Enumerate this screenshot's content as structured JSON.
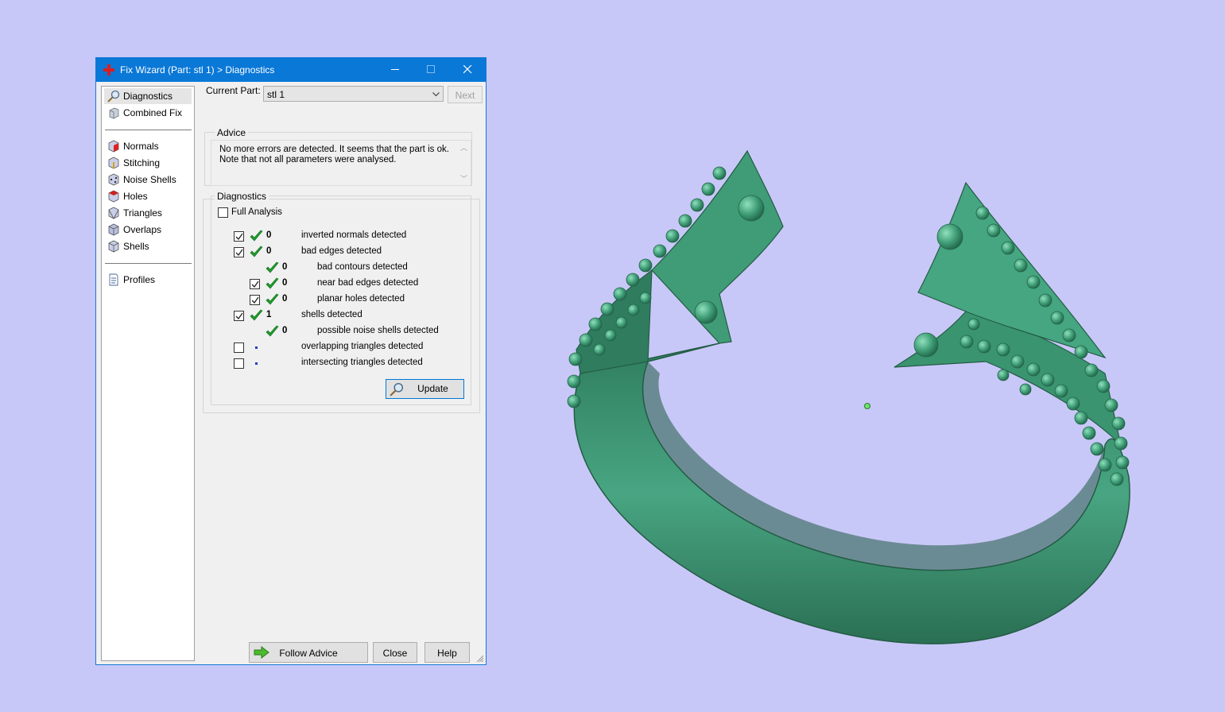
{
  "window": {
    "title": "Fix Wizard (Part: stl 1) > Diagnostics",
    "controls": {
      "minimize": "minimize",
      "maximize": "maximize",
      "close": "close"
    }
  },
  "sidebar": {
    "items": [
      {
        "label": "Diagnostics",
        "icon": "diagnostics-magnifier-icon"
      },
      {
        "label": "Combined Fix",
        "icon": "combined-fix-icon"
      },
      {
        "label": "Normals",
        "icon": "normals-cube-icon"
      },
      {
        "label": "Stitching",
        "icon": "stitching-cube-icon"
      },
      {
        "label": "Noise Shells",
        "icon": "noise-shells-cube-icon"
      },
      {
        "label": "Holes",
        "icon": "holes-cube-icon"
      },
      {
        "label": "Triangles",
        "icon": "triangles-cube-icon"
      },
      {
        "label": "Overlaps",
        "icon": "overlaps-cube-icon"
      },
      {
        "label": "Shells",
        "icon": "shells-cube-icon"
      },
      {
        "label": "Profiles",
        "icon": "profiles-document-icon"
      }
    ],
    "selected": "Diagnostics"
  },
  "current_part": {
    "label": "Current Part:",
    "value": "stl 1",
    "next_label": "Next"
  },
  "advice": {
    "title": "Advice",
    "text": "No more errors are detected. It seems that the part is ok.\nNote that not all parameters were analysed."
  },
  "diagnostics": {
    "title": "Diagnostics",
    "full_analysis_label": "Full Analysis",
    "full_analysis_checked": false,
    "rows": [
      {
        "checkbox": true,
        "checked": true,
        "status": "ok",
        "count": "0",
        "label": "inverted normals detected",
        "indent": 0
      },
      {
        "checkbox": true,
        "checked": true,
        "status": "ok",
        "count": "0",
        "label": "bad edges detected",
        "indent": 0
      },
      {
        "checkbox": false,
        "checked": false,
        "status": "ok",
        "count": "0",
        "label": "bad contours detected",
        "indent": 1
      },
      {
        "checkbox": true,
        "checked": true,
        "status": "ok",
        "count": "0",
        "label": "near bad edges detected",
        "indent": 1
      },
      {
        "checkbox": true,
        "checked": true,
        "status": "ok",
        "count": "0",
        "label": "planar holes detected",
        "indent": 1
      },
      {
        "checkbox": true,
        "checked": true,
        "status": "ok",
        "count": "1",
        "label": "shells detected",
        "indent": 0
      },
      {
        "checkbox": false,
        "checked": false,
        "status": "ok",
        "count": "0",
        "label": "possible noise shells detected",
        "indent": 1
      },
      {
        "checkbox": true,
        "checked": false,
        "status": "not-analysed",
        "count": "",
        "label": "overlapping triangles detected",
        "indent": 0
      },
      {
        "checkbox": true,
        "checked": false,
        "status": "not-analysed",
        "count": "",
        "label": "intersecting triangles detected",
        "indent": 0
      }
    ],
    "update_label": "Update"
  },
  "footer": {
    "follow_label": "Follow Advice",
    "close_label": "Close",
    "help_label": "Help"
  },
  "colors": {
    "title_bar": "#0a78d7",
    "background": "#c8c8f8",
    "model": "#3d9a74",
    "check": "#1f9a2c"
  }
}
